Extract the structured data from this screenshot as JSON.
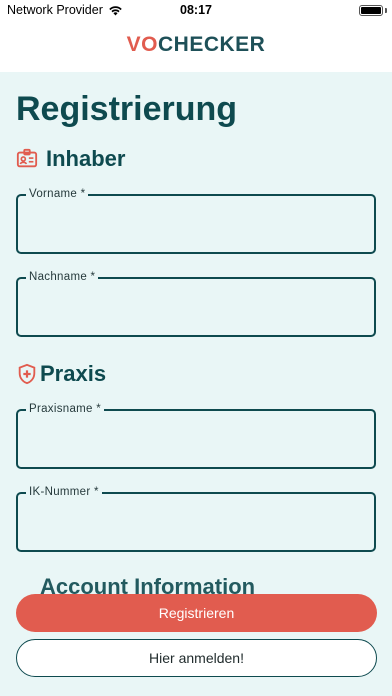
{
  "status_bar": {
    "carrier": "Network Provider",
    "time": "08:17"
  },
  "header": {
    "logo_part1": "VO",
    "logo_part2": "CHECKER"
  },
  "page": {
    "title": "Registrierung"
  },
  "sections": {
    "owner": {
      "title": "Inhaber",
      "icon": "id-badge-icon"
    },
    "practice": {
      "title": "Praxis",
      "icon": "shield-plus-icon"
    }
  },
  "fields": {
    "first_name": {
      "label": "Vorname *",
      "value": ""
    },
    "last_name": {
      "label": "Nachname *",
      "value": ""
    },
    "practice_name": {
      "label": "Praxisname *",
      "value": ""
    },
    "ik_number": {
      "label": "IK-Nummer *",
      "value": ""
    }
  },
  "partial_section_title": "Account Information",
  "buttons": {
    "register": "Registrieren",
    "login": "Hier anmelden!"
  },
  "colors": {
    "accent": "#e15c4f",
    "primary": "#0e4a4f",
    "background": "#e9f6f6"
  }
}
